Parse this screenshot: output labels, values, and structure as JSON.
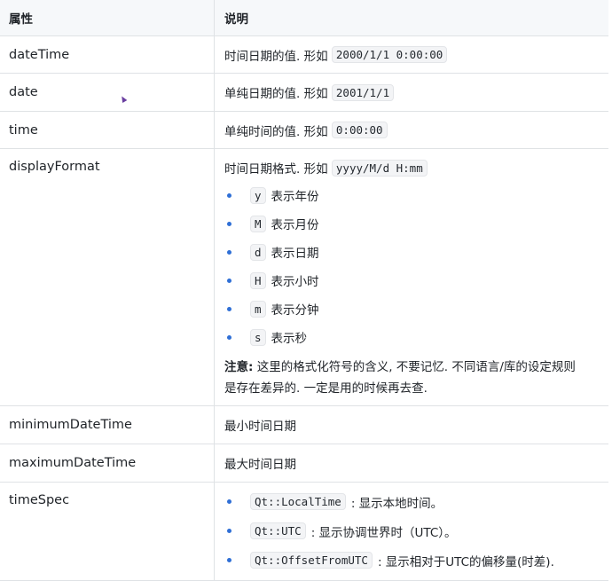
{
  "header": {
    "col1": "属性",
    "col2": "说明"
  },
  "rows": {
    "datetime": {
      "name": "dateTime",
      "desc": "时间日期的值. 形如",
      "code": "2000/1/1 0:00:00"
    },
    "date": {
      "name": "date",
      "desc": "单纯日期的值. 形如",
      "code": "2001/1/1"
    },
    "time": {
      "name": "time",
      "desc": "单纯时间的值. 形如",
      "code": "0:00:00"
    },
    "displayformat": {
      "name": "displayFormat",
      "desc": "时间日期格式. 形如",
      "code": "yyyy/M/d H:mm",
      "bullets": [
        {
          "code": "y",
          "text": "表示年份"
        },
        {
          "code": "M",
          "text": "表示月份"
        },
        {
          "code": "d",
          "text": "表示日期"
        },
        {
          "code": "H",
          "text": "表示小时"
        },
        {
          "code": "m",
          "text": "表示分钟"
        },
        {
          "code": "s",
          "text": "表示秒"
        }
      ],
      "note_label": "注意:",
      "note_line1": " 这里的格式化符号的含义, 不要记忆. 不同语言/库的设定规则",
      "note_line2": "是存在差异的. 一定是用的时候再去查."
    },
    "minimum": {
      "name": "minimumDateTime",
      "desc": "最小时间日期"
    },
    "maximum": {
      "name": "maximumDateTime",
      "desc": "最大时间日期"
    },
    "timespec": {
      "name": "timeSpec",
      "bullets": [
        {
          "code": "Qt::LocalTime",
          "text": ": 显示本地时间。"
        },
        {
          "code": "Qt::UTC",
          "text": ": 显示协调世界时（UTC）。"
        },
        {
          "code": "Qt::OffsetFromUTC",
          "text": ": 显示相对于UTC的偏移量(时差)."
        }
      ]
    }
  },
  "colors": {
    "bullet": "#2f6fd6",
    "border": "#dfe2e5",
    "header_bg": "#f6f8fa"
  }
}
